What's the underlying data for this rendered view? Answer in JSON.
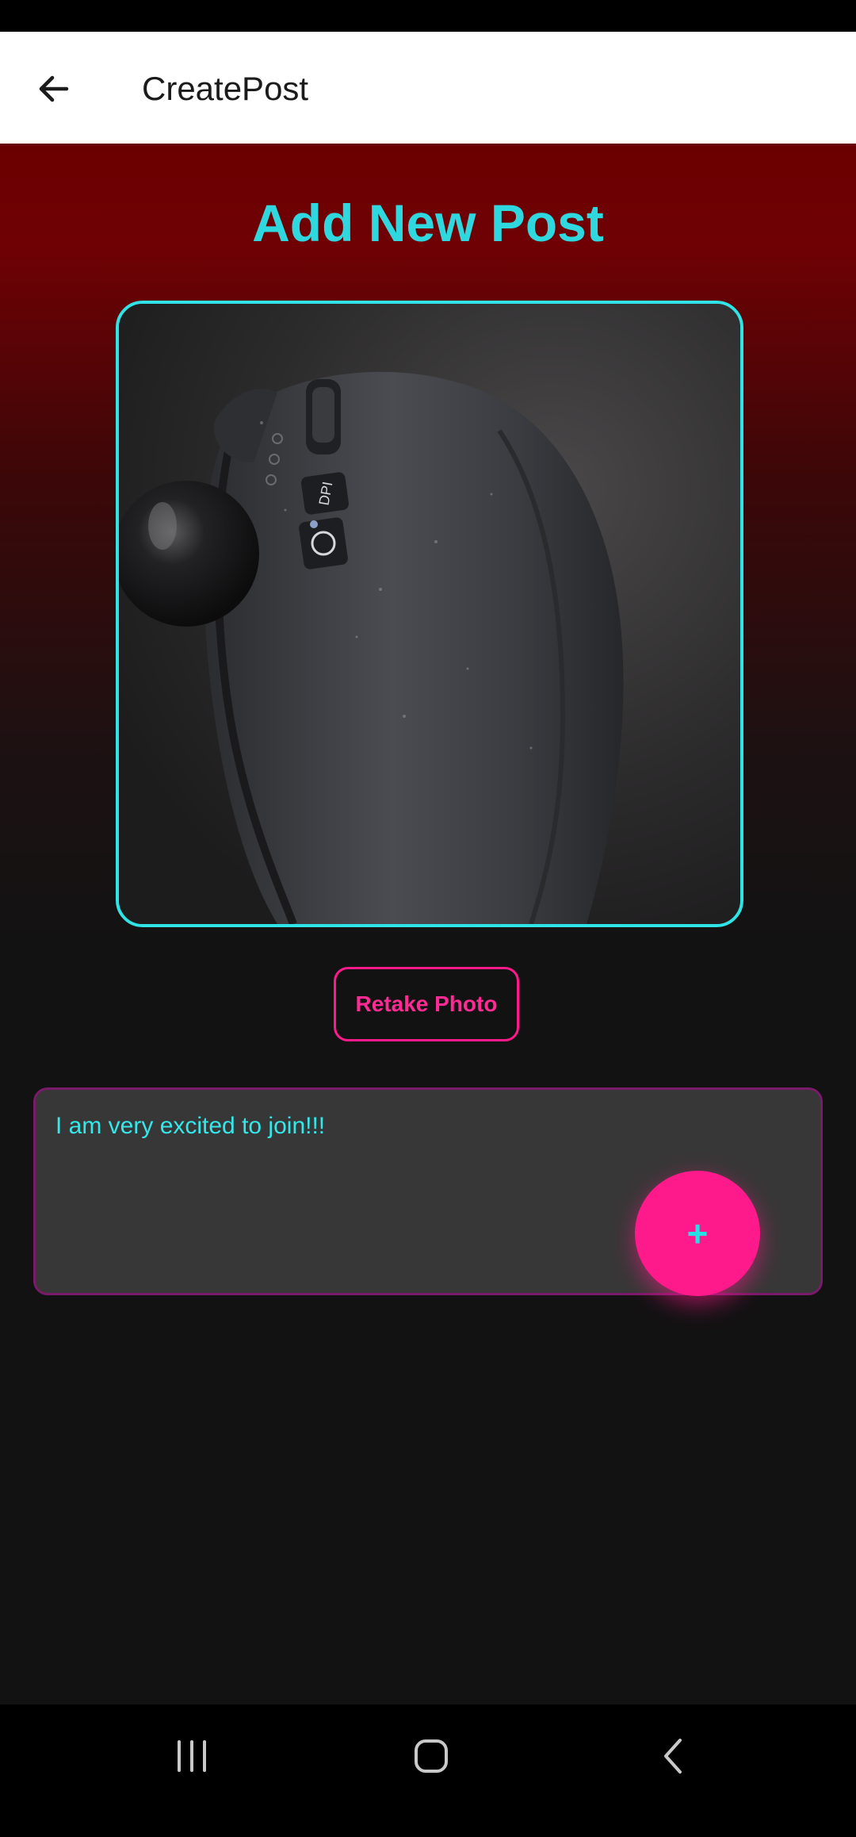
{
  "app_bar": {
    "title": "CreatePost",
    "back_icon": "arrow-left-icon"
  },
  "page": {
    "heading": "Add New Post"
  },
  "photo": {
    "subject": "trackball-mouse-photo",
    "button_labels": [
      "DPI"
    ]
  },
  "actions": {
    "retake_label": "Retake Photo"
  },
  "caption": {
    "value": "I am very excited to join!!!"
  },
  "fab": {
    "label": "+",
    "icon": "plus-icon"
  },
  "nav": {
    "items": [
      "recent-apps-icon",
      "home-icon",
      "back-icon"
    ]
  },
  "colors": {
    "accent_cyan": "#2fd8de",
    "accent_pink": "#ff1a8c",
    "header_red": "#6b0000",
    "background": "#131213"
  }
}
